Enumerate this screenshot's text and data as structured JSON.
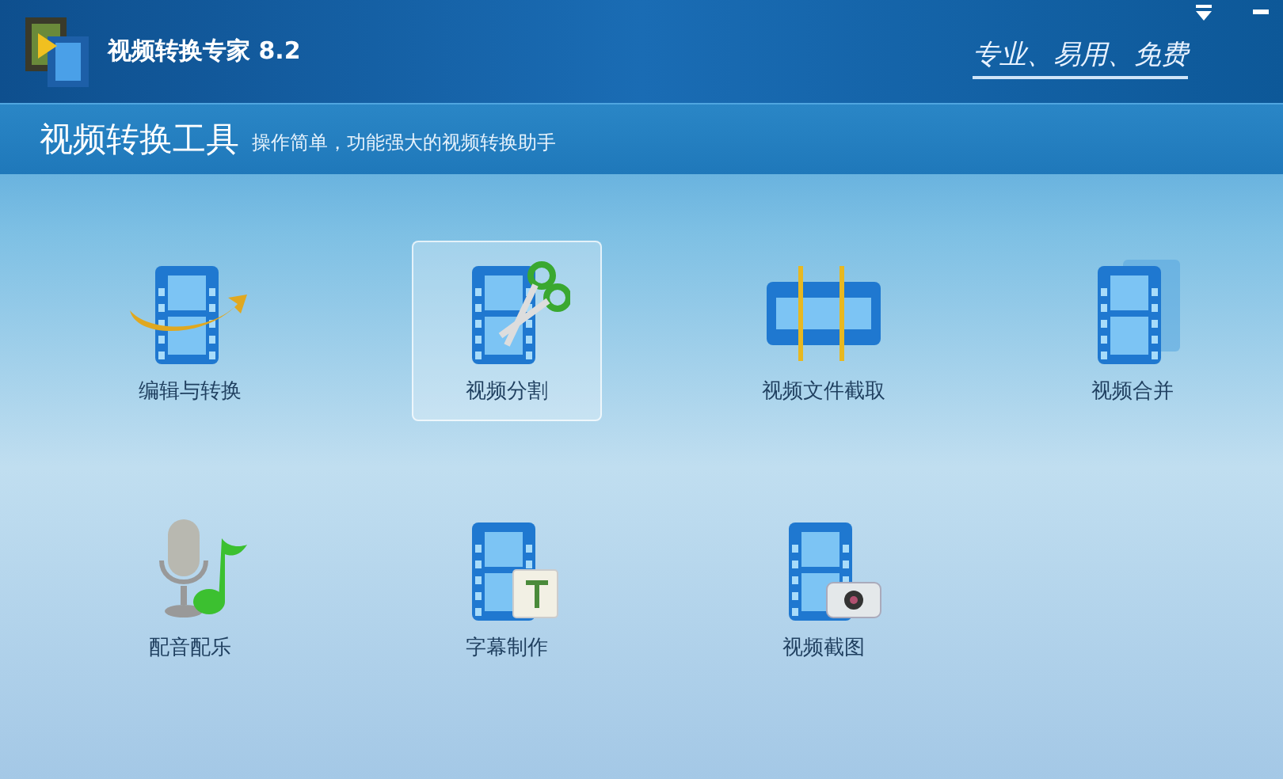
{
  "window": {
    "title": "视频转换专家 8.2",
    "slogan": "专业、易用、免费"
  },
  "header": {
    "title": "视频转换工具",
    "subtitle": "操作简单，功能强大的视频转换助手"
  },
  "tools": [
    {
      "label": "编辑与转换",
      "kind": "convert",
      "selected": false
    },
    {
      "label": "视频分割",
      "kind": "split",
      "selected": true
    },
    {
      "label": "视频文件截取",
      "kind": "clip",
      "selected": false
    },
    {
      "label": "视频合并",
      "kind": "merge",
      "selected": false
    },
    {
      "label": "配音配乐",
      "kind": "audio",
      "selected": false
    },
    {
      "label": "字幕制作",
      "kind": "subtitle",
      "selected": false
    },
    {
      "label": "视频截图",
      "kind": "snapshot",
      "selected": false
    }
  ]
}
